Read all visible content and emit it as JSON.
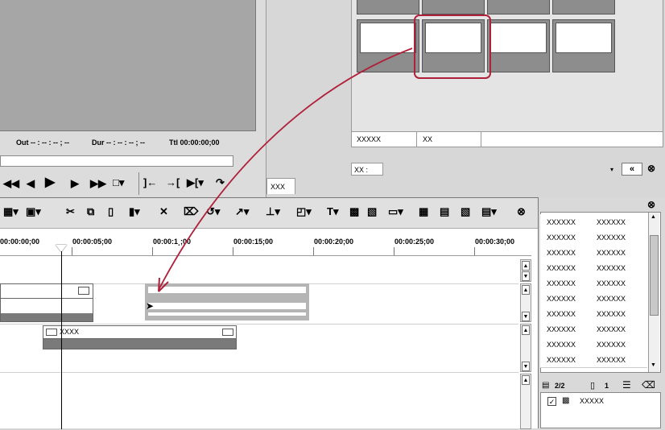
{
  "player": {
    "out": "Out -- : -- : -- ; --",
    "dur": "Dur -- : -- : -- ; --",
    "ttl": "Ttl 00:00:00;00"
  },
  "right_panel": {
    "props_col1": "XXXXX",
    "props_col2": "XX",
    "xx_label": "XX :",
    "tab_label": "XXX"
  },
  "timeline": {
    "ruler": [
      "00:00:00;00",
      "00:00:05;00",
      "00:00:1¸;00",
      "00:00:15;00",
      "00:00:20;00",
      "00:00:25;00",
      "00:00:30;00"
    ],
    "clip_label": "XXXX"
  },
  "bin": {
    "rows": [
      [
        "XXXXXX",
        "XXXXXX"
      ],
      [
        "XXXXXX",
        "XXXXXX"
      ],
      [
        "XXXXXX",
        "XXXXXX"
      ],
      [
        "XXXXXX",
        "XXXXXX"
      ],
      [
        "XXXXXX",
        "XXXXXX"
      ],
      [
        "XXXXXX",
        "XXXXXX"
      ],
      [
        "XXXXXX",
        "XXXXXX"
      ],
      [
        "XXXXXX",
        "XXXXXX"
      ],
      [
        "XXXXXX",
        "XXXXXX"
      ],
      [
        "XXXXXX",
        "XXXXXX"
      ]
    ],
    "page": "2/2",
    "count": "1",
    "item_label": "XXXXX"
  },
  "colors": {
    "accent": "#b0203a"
  }
}
